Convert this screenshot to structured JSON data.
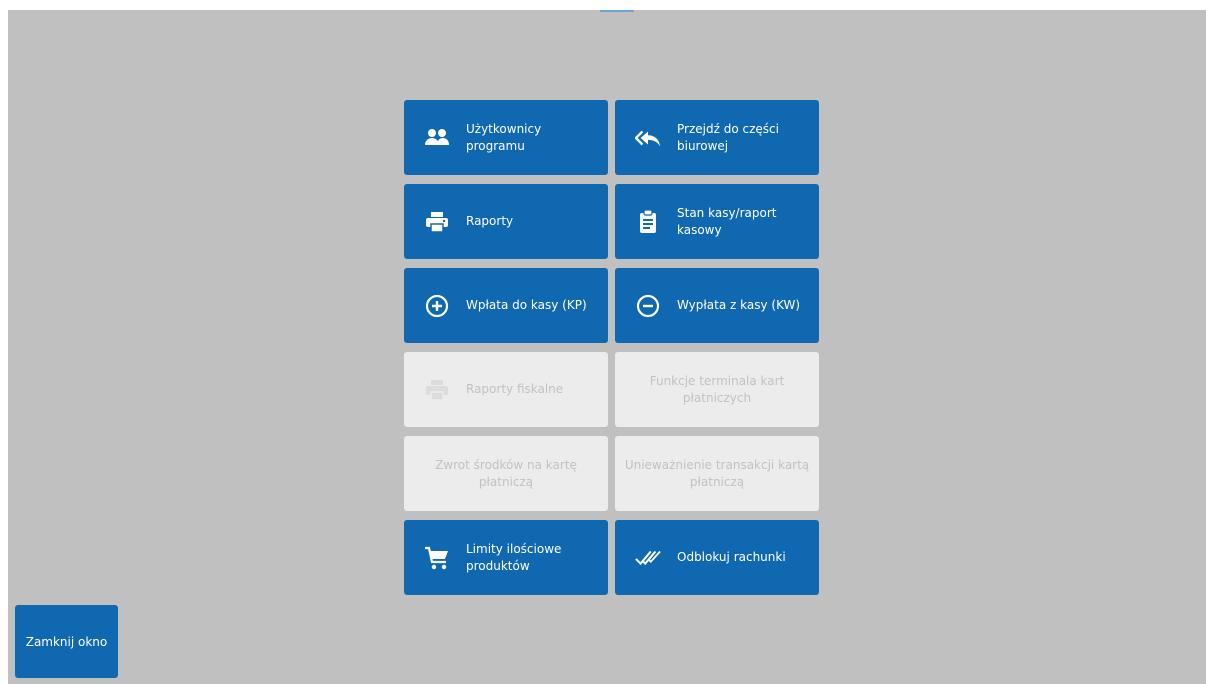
{
  "colors": {
    "tile_active": "#1068b0",
    "tile_disabled": "#ececec",
    "background": "#c0c0c0"
  },
  "tiles": [
    {
      "label": "Użytkownicy programu",
      "icon": "users-icon",
      "enabled": true
    },
    {
      "label": "Przejdź do części biurowej",
      "icon": "reply-all-icon",
      "enabled": true
    },
    {
      "label": "Raporty",
      "icon": "printer-icon",
      "enabled": true
    },
    {
      "label": "Stan kasy/raport kasowy",
      "icon": "clipboard-icon",
      "enabled": true
    },
    {
      "label": "Wpłata do kasy (KP)",
      "icon": "plus-circle-icon",
      "enabled": true
    },
    {
      "label": "Wypłata z kasy (KW)",
      "icon": "minus-circle-icon",
      "enabled": true
    },
    {
      "label": "Raporty fiskalne",
      "icon": "printer-icon",
      "enabled": false
    },
    {
      "label": "Funkcje terminala kart płatniczych",
      "icon": "",
      "enabled": false
    },
    {
      "label": "Zwrot środków na kartę płatniczą",
      "icon": "",
      "enabled": false
    },
    {
      "label": "Unieważnienie transakcji kartą płatniczą",
      "icon": "",
      "enabled": false
    },
    {
      "label": "Limity ilościowe produktów",
      "icon": "cart-icon",
      "enabled": true
    },
    {
      "label": "Odblokuj rachunki",
      "icon": "double-check-icon",
      "enabled": true
    }
  ],
  "close_button": {
    "label": "Zamknij okno"
  }
}
